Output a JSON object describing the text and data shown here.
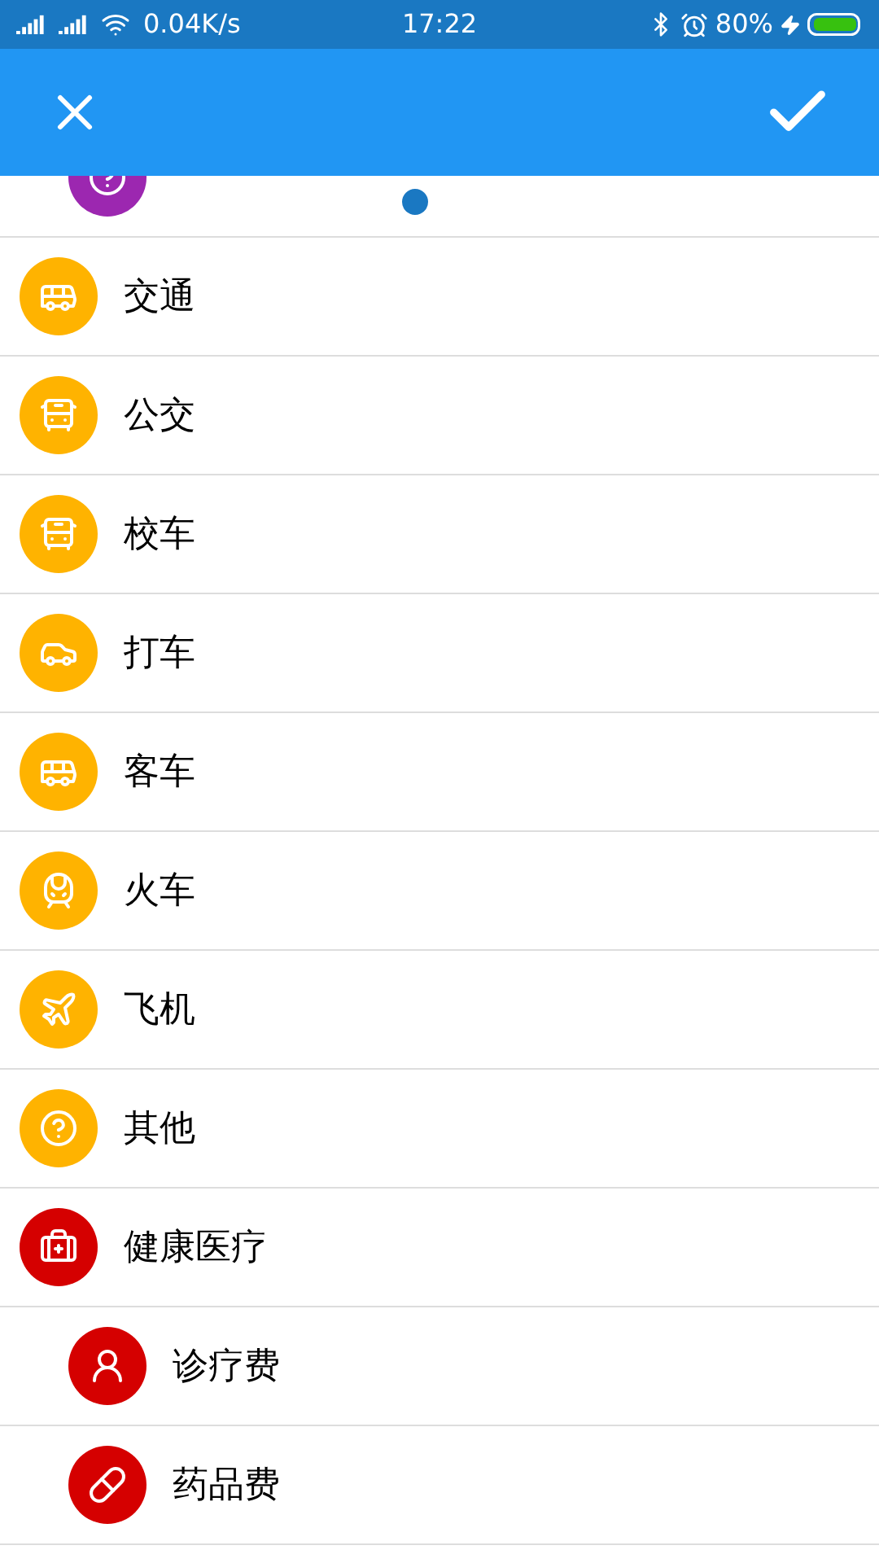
{
  "status_bar": {
    "net_speed": "0.04K/s",
    "time": "17:22",
    "battery": "80%"
  },
  "items": [
    {
      "children": [
        {
          "kind": "question",
          "color": "#9c27b0"
        }
      ]
    },
    {
      "label": "交通",
      "kind": "bus",
      "color": "#ffb300"
    },
    {
      "label": "公交",
      "kind": "minibus",
      "color": "#ffb300"
    },
    {
      "label": "校车",
      "kind": "minibus",
      "color": "#ffb300"
    },
    {
      "label": "打车",
      "kind": "car",
      "color": "#ffb300"
    },
    {
      "label": "客车",
      "kind": "bus",
      "color": "#ffb300"
    },
    {
      "label": "火车",
      "kind": "train",
      "color": "#ffb300"
    },
    {
      "label": "飞机",
      "kind": "plane",
      "color": "#ffb300"
    },
    {
      "label": "其他",
      "kind": "question",
      "color": "#ffb300"
    },
    {
      "label": "健康医疗",
      "kind": "medkit",
      "color": "#d50000",
      "children": [
        {
          "label": "诊疗费",
          "kind": "doctor",
          "color": "#d50000"
        },
        {
          "label": "药品费",
          "kind": "pills",
          "color": "#d50000"
        }
      ]
    }
  ]
}
